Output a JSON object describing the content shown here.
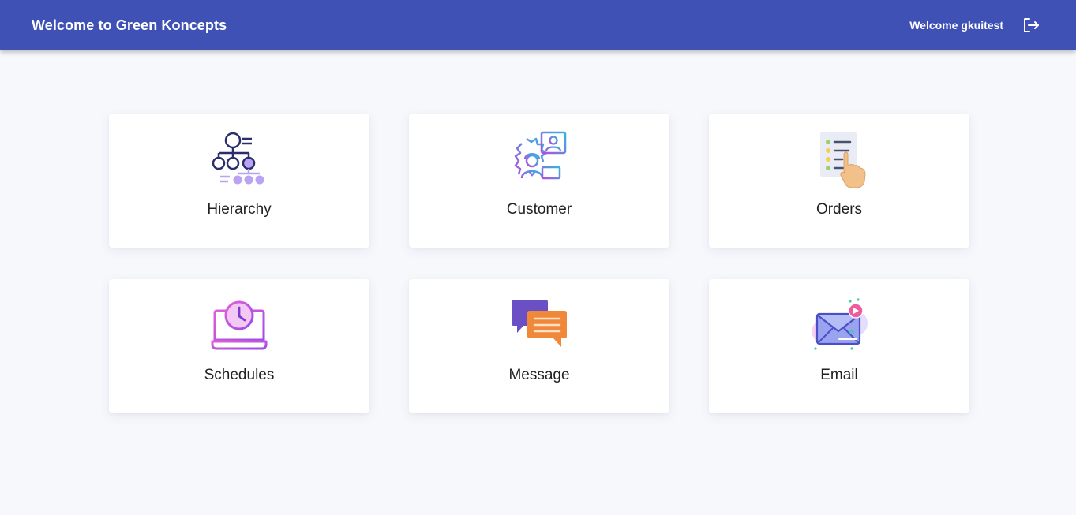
{
  "header": {
    "title": "Welcome to Green Koncepts",
    "welcome_text": "Welcome gkuitest",
    "logout_icon": "logout-icon",
    "background_color": "#3f51b5",
    "text_color": "#ffffff"
  },
  "page": {
    "background_color": "#f7f8fc"
  },
  "cards": [
    {
      "label": "Hierarchy",
      "icon": "hierarchy-icon"
    },
    {
      "label": "Customer",
      "icon": "customer-icon"
    },
    {
      "label": "Orders",
      "icon": "orders-icon"
    },
    {
      "label": "Schedules",
      "icon": "schedules-icon"
    },
    {
      "label": "Message",
      "icon": "message-icon"
    },
    {
      "label": "Email",
      "icon": "email-icon"
    }
  ]
}
